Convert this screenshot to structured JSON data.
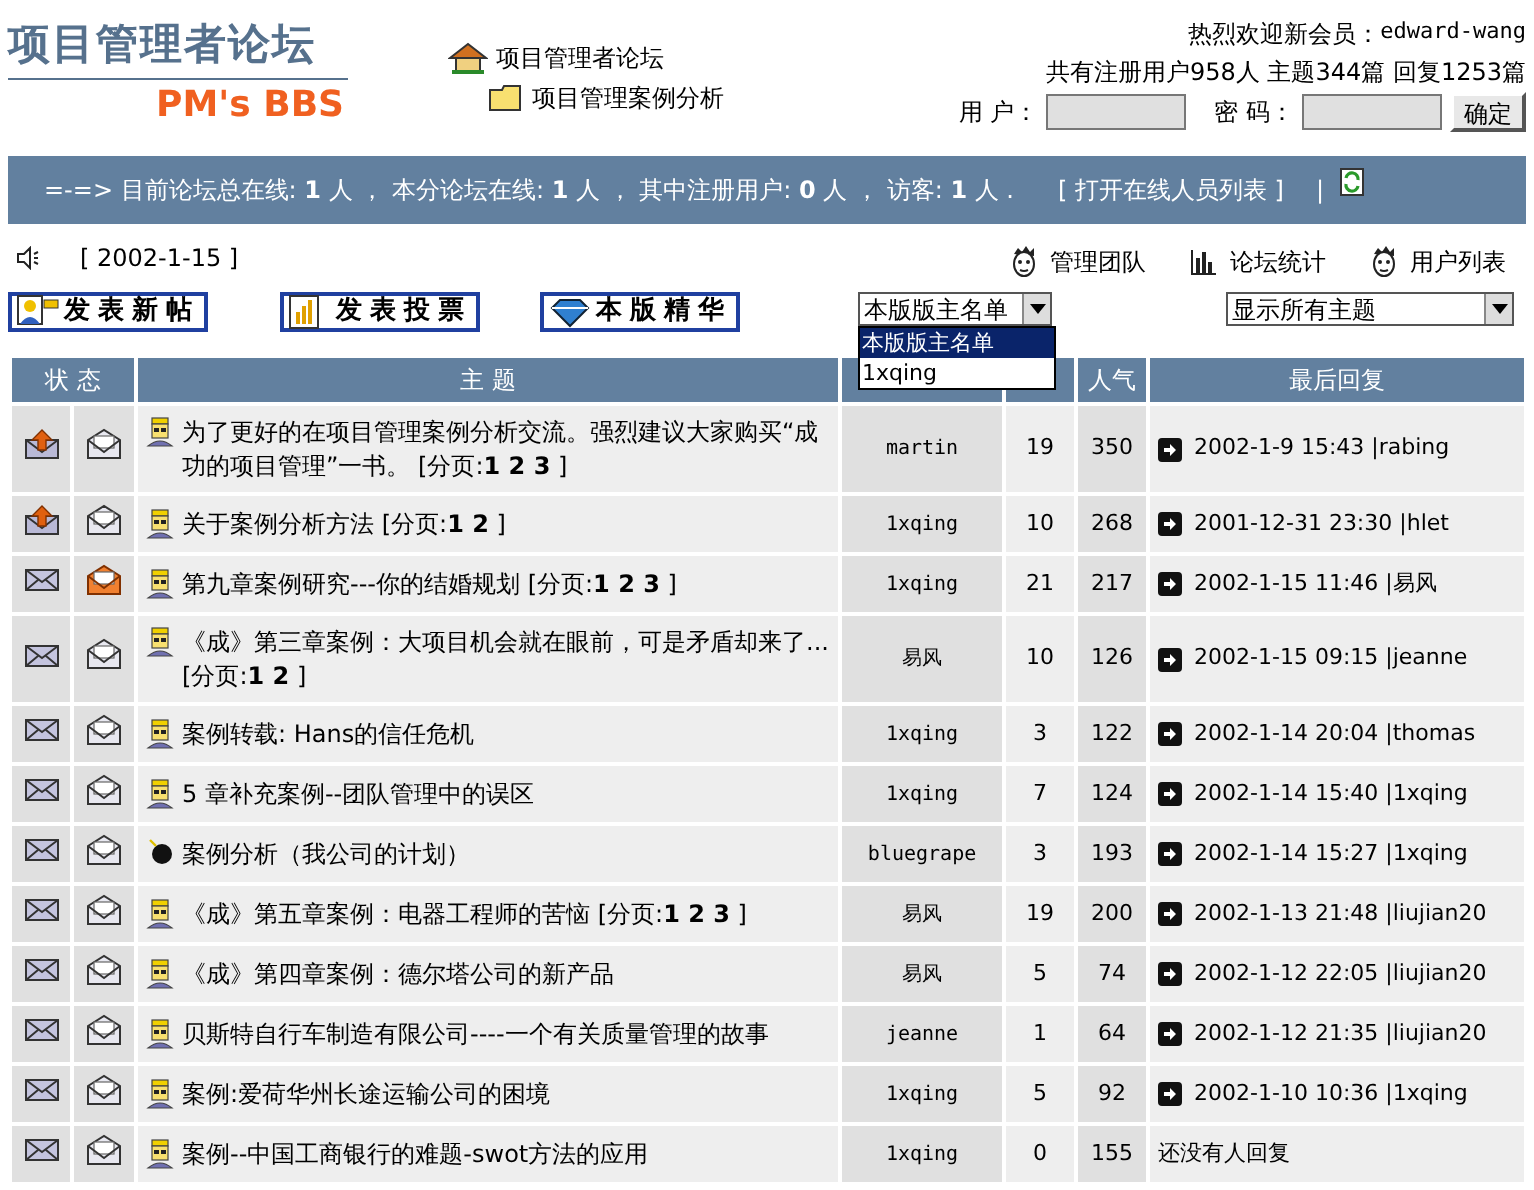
{
  "logo": {
    "title": "项目管理者论坛",
    "subtitle": "PM's BBS"
  },
  "breadcrumb": [
    {
      "label": "项目管理者论坛",
      "kind": "home"
    },
    {
      "label": "项目管理案例分析",
      "kind": "folder"
    }
  ],
  "welcome": {
    "label": "热烈欢迎新会员：",
    "user": "edward-wang"
  },
  "stats": "共有注册用户958人 主题344篇 回复1253篇",
  "login": {
    "user_label": "用 户：",
    "password_label": "密 码：",
    "submit": "确定"
  },
  "online_bar": {
    "text": "=-=> 目前论坛总在线: **1** 人 ， 本分论坛在线: **1** 人 ， 其中注册用户: **0** 人 ， 访客: **1** 人 .",
    "link": "[ 打开在线人员列表 ]",
    "separator": "|"
  },
  "date": "[ 2002-1-15 ]",
  "top_links": [
    {
      "label": "管理团队",
      "kind": "face"
    },
    {
      "label": "论坛统计",
      "kind": "chart"
    },
    {
      "label": "用户列表",
      "kind": "face"
    }
  ],
  "action_buttons": [
    {
      "label": "发表新帖",
      "kind": "post"
    },
    {
      "label": "发表投票",
      "kind": "vote"
    },
    {
      "label": "本版精华",
      "kind": "gem"
    }
  ],
  "moderator_select": {
    "value": "本版版主名单",
    "expanded": true,
    "options": [
      {
        "label": "本版版主名单",
        "selected": true
      },
      {
        "label": "1xqing",
        "selected": false
      }
    ]
  },
  "filter_select": {
    "value": "显示所有主题"
  },
  "table": {
    "columns": [
      {
        "label": "状 态"
      },
      {
        "label": "主 题"
      },
      {},
      {},
      {
        "label": "人气"
      },
      {
        "label": "最后回复"
      }
    ],
    "rows": [
      {
        "status_icons": [
          {
            "kind": "hot"
          },
          {
            "kind": "read"
          }
        ],
        "topic_icon": {
          "kind": "face"
        },
        "title": "为了更好的在项目管理案例分析交流。强烈建议大家购买“成功的项目管理”一书。 [分页:**1 2 3** ]",
        "author": "martin",
        "replies": "19",
        "hits": "350",
        "last": "2002-1-9 15:43 |rabing"
      },
      {
        "status_icons": [
          {
            "kind": "hot"
          },
          {
            "kind": "read"
          }
        ],
        "topic_icon": {
          "kind": "face"
        },
        "title": "关于案例分析方法 [分页:**1 2** ]",
        "author": "1xqing",
        "replies": "10",
        "hits": "268",
        "last": "2001-12-31 23:30 |hlet"
      },
      {
        "status_icons": [
          {
            "kind": "normal"
          },
          {
            "kind": "new"
          }
        ],
        "topic_icon": {
          "kind": "face"
        },
        "title": "第九章案例研究---你的结婚规划 [分页:**1 2 3** ]",
        "author": "1xqing",
        "replies": "21",
        "hits": "217",
        "last": "2002-1-15 11:46 |易风"
      },
      {
        "status_icons": [
          {
            "kind": "normal"
          },
          {
            "kind": "read"
          }
        ],
        "topic_icon": {
          "kind": "face"
        },
        "title": "《成》第三章案例：大项目机会就在眼前，可是矛盾却来了... [分页:**1 2** ]",
        "author": "易风",
        "replies": "10",
        "hits": "126",
        "last": "2002-1-15 09:15 |jeanne"
      },
      {
        "status_icons": [
          {
            "kind": "normal"
          },
          {
            "kind": "read"
          }
        ],
        "topic_icon": {
          "kind": "face"
        },
        "title": "案例转载: Hans的信任危机",
        "author": "1xqing",
        "replies": "3",
        "hits": "122",
        "last": "2002-1-14 20:04 |thomas"
      },
      {
        "status_icons": [
          {
            "kind": "normal"
          },
          {
            "kind": "read"
          }
        ],
        "topic_icon": {
          "kind": "face"
        },
        "title": "5 章补充案例--团队管理中的误区",
        "author": "1xqing",
        "replies": "7",
        "hits": "124",
        "last": "2002-1-14 15:40 |1xqing"
      },
      {
        "status_icons": [
          {
            "kind": "normal"
          },
          {
            "kind": "read"
          }
        ],
        "topic_icon": {
          "kind": "bomb"
        },
        "title": "案例分析（我公司的计划）",
        "author": "bluegrape",
        "replies": "3",
        "hits": "193",
        "last": "2002-1-14 15:27 |1xqing"
      },
      {
        "status_icons": [
          {
            "kind": "normal"
          },
          {
            "kind": "read"
          }
        ],
        "topic_icon": {
          "kind": "face"
        },
        "title": "《成》第五章案例：电器工程师的苦恼 [分页:**1 2 3** ]",
        "author": "易风",
        "replies": "19",
        "hits": "200",
        "last": "2002-1-13 21:48 |liujian20"
      },
      {
        "status_icons": [
          {
            "kind": "normal"
          },
          {
            "kind": "read"
          }
        ],
        "topic_icon": {
          "kind": "face"
        },
        "title": "《成》第四章案例：德尔塔公司的新产品",
        "author": "易风",
        "replies": "5",
        "hits": "74",
        "last": "2002-1-12 22:05 |liujian20"
      },
      {
        "status_icons": [
          {
            "kind": "normal"
          },
          {
            "kind": "read"
          }
        ],
        "topic_icon": {
          "kind": "face"
        },
        "title": "贝斯特自行车制造有限公司----一个有关质量管理的故事",
        "author": "jeanne",
        "replies": "1",
        "hits": "64",
        "last": "2002-1-12 21:35 |liujian20"
      },
      {
        "status_icons": [
          {
            "kind": "normal"
          },
          {
            "kind": "read"
          }
        ],
        "topic_icon": {
          "kind": "face"
        },
        "title": "案例:爱荷华州长途运输公司的困境",
        "author": "1xqing",
        "replies": "5",
        "hits": "92",
        "last": "2002-1-10 10:36 |1xqing"
      },
      {
        "status_icons": [
          {
            "kind": "normal"
          },
          {
            "kind": "read"
          }
        ],
        "topic_icon": {
          "kind": "face"
        },
        "title": "案例--中国工商银行的难题-swot方法的应用",
        "author": "1xqing",
        "replies": "0",
        "hits": "155",
        "last": "还没有人回复"
      }
    ]
  }
}
